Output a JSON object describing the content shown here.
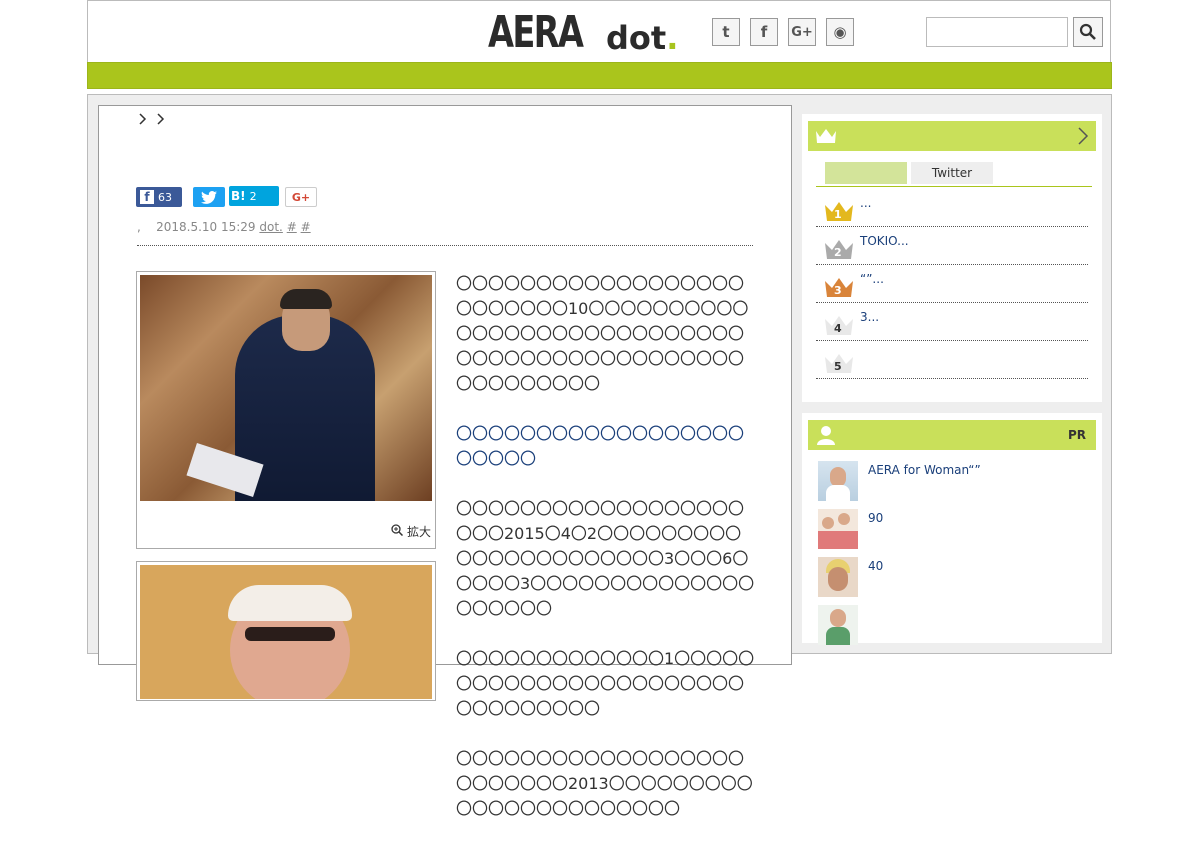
{
  "brand": {
    "logo_main": "AERA",
    "logo_sub": "dot",
    "logo_mark": "."
  },
  "header": {
    "social": [
      {
        "name": "twitter-icon",
        "glyph": "t"
      },
      {
        "name": "facebook-icon",
        "glyph": "f"
      },
      {
        "name": "google-plus-icon",
        "glyph": "G+"
      },
      {
        "name": "rss-icon",
        "glyph": "◉"
      }
    ],
    "search_placeholder": ""
  },
  "article": {
    "share": {
      "facebook_count": "63",
      "hatena_label": "B!",
      "hatena_count": "2",
      "gplus_label": "G+"
    },
    "meta": {
      "sep": ",",
      "date": "2018.5.10 15:29",
      "source": "dot.",
      "tag1": "#",
      "tag2": "#"
    },
    "zoom_label": "拡大",
    "paragraphs": [
      "〇〇〇〇〇〇〇〇〇〇〇〇〇〇〇〇〇〇〇〇〇〇〇〇〇10〇〇〇〇〇〇〇〇〇〇〇〇〇〇〇〇〇〇〇〇〇〇〇〇〇〇〇〇〇〇〇〇〇〇〇〇〇〇〇〇〇〇〇〇〇〇〇〇〇〇〇〇〇〇〇",
      "〇〇〇〇〇〇〇〇〇〇〇〇〇〇〇〇〇〇〇〇〇〇〇",
      "〇〇〇〇〇〇〇〇〇〇〇〇〇〇〇〇〇〇〇〇〇2015〇4〇2〇〇〇〇〇〇〇〇〇〇〇〇〇〇〇〇〇〇〇〇〇〇3〇〇〇6〇〇〇〇〇3〇〇〇〇〇〇〇〇〇〇〇〇〇〇〇〇〇〇〇〇",
      "〇〇〇〇〇〇〇〇〇〇〇〇〇1〇〇〇〇〇〇〇〇〇〇〇〇〇〇〇〇〇〇〇〇〇〇〇〇〇〇〇〇〇〇〇〇",
      "〇〇〇〇〇〇〇〇〇〇〇〇〇〇〇〇〇〇〇〇〇〇〇〇〇2013〇〇〇〇〇〇〇〇〇〇〇〇〇〇〇〇〇〇〇〇〇〇〇"
    ]
  },
  "ranking": {
    "tabs": [
      "",
      "Twitter"
    ],
    "items": [
      {
        "rank": "1",
        "text": "...",
        "color": "#e3b81e"
      },
      {
        "rank": "2",
        "text": "TOKIO...",
        "color": "#aaaaaa"
      },
      {
        "rank": "3",
        "text": "“”...",
        "color": "#d9843a"
      },
      {
        "rank": "4",
        "text": "3...",
        "color": "#e8e8e8"
      },
      {
        "rank": "5",
        "text": "",
        "color": "#e8e8e8"
      }
    ]
  },
  "pr": {
    "label": "PR",
    "items": [
      {
        "text": "AERA for Woman“”"
      },
      {
        "text": "90"
      },
      {
        "text": "40"
      },
      {
        "text": ""
      }
    ]
  },
  "colors": {
    "accent": "#aac51c",
    "side_head": "#c9e05a",
    "link": "#1a3f7a"
  }
}
